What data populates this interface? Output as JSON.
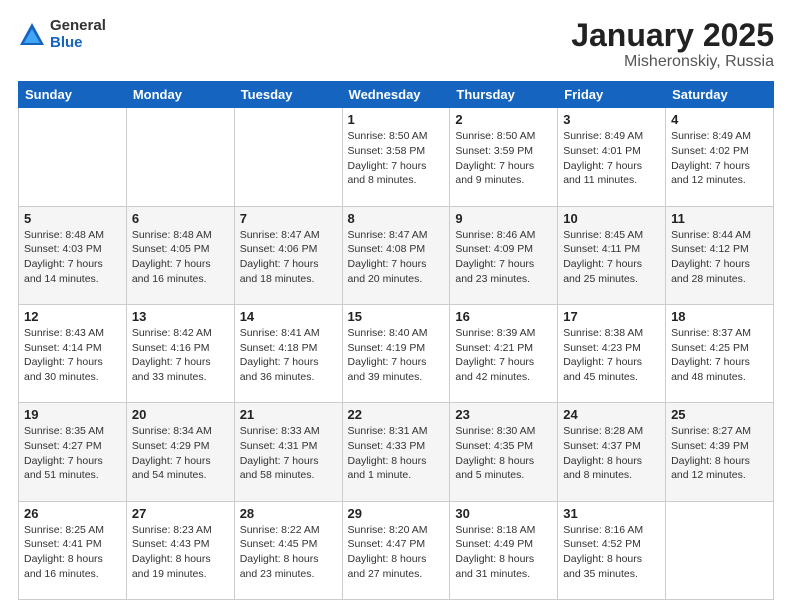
{
  "logo": {
    "general": "General",
    "blue": "Blue"
  },
  "title": "January 2025",
  "subtitle": "Misheronskiy, Russia",
  "days_header": [
    "Sunday",
    "Monday",
    "Tuesday",
    "Wednesday",
    "Thursday",
    "Friday",
    "Saturday"
  ],
  "weeks": [
    [
      {
        "day": "",
        "detail": ""
      },
      {
        "day": "",
        "detail": ""
      },
      {
        "day": "",
        "detail": ""
      },
      {
        "day": "1",
        "detail": "Sunrise: 8:50 AM\nSunset: 3:58 PM\nDaylight: 7 hours\nand 8 minutes."
      },
      {
        "day": "2",
        "detail": "Sunrise: 8:50 AM\nSunset: 3:59 PM\nDaylight: 7 hours\nand 9 minutes."
      },
      {
        "day": "3",
        "detail": "Sunrise: 8:49 AM\nSunset: 4:01 PM\nDaylight: 7 hours\nand 11 minutes."
      },
      {
        "day": "4",
        "detail": "Sunrise: 8:49 AM\nSunset: 4:02 PM\nDaylight: 7 hours\nand 12 minutes."
      }
    ],
    [
      {
        "day": "5",
        "detail": "Sunrise: 8:48 AM\nSunset: 4:03 PM\nDaylight: 7 hours\nand 14 minutes."
      },
      {
        "day": "6",
        "detail": "Sunrise: 8:48 AM\nSunset: 4:05 PM\nDaylight: 7 hours\nand 16 minutes."
      },
      {
        "day": "7",
        "detail": "Sunrise: 8:47 AM\nSunset: 4:06 PM\nDaylight: 7 hours\nand 18 minutes."
      },
      {
        "day": "8",
        "detail": "Sunrise: 8:47 AM\nSunset: 4:08 PM\nDaylight: 7 hours\nand 20 minutes."
      },
      {
        "day": "9",
        "detail": "Sunrise: 8:46 AM\nSunset: 4:09 PM\nDaylight: 7 hours\nand 23 minutes."
      },
      {
        "day": "10",
        "detail": "Sunrise: 8:45 AM\nSunset: 4:11 PM\nDaylight: 7 hours\nand 25 minutes."
      },
      {
        "day": "11",
        "detail": "Sunrise: 8:44 AM\nSunset: 4:12 PM\nDaylight: 7 hours\nand 28 minutes."
      }
    ],
    [
      {
        "day": "12",
        "detail": "Sunrise: 8:43 AM\nSunset: 4:14 PM\nDaylight: 7 hours\nand 30 minutes."
      },
      {
        "day": "13",
        "detail": "Sunrise: 8:42 AM\nSunset: 4:16 PM\nDaylight: 7 hours\nand 33 minutes."
      },
      {
        "day": "14",
        "detail": "Sunrise: 8:41 AM\nSunset: 4:18 PM\nDaylight: 7 hours\nand 36 minutes."
      },
      {
        "day": "15",
        "detail": "Sunrise: 8:40 AM\nSunset: 4:19 PM\nDaylight: 7 hours\nand 39 minutes."
      },
      {
        "day": "16",
        "detail": "Sunrise: 8:39 AM\nSunset: 4:21 PM\nDaylight: 7 hours\nand 42 minutes."
      },
      {
        "day": "17",
        "detail": "Sunrise: 8:38 AM\nSunset: 4:23 PM\nDaylight: 7 hours\nand 45 minutes."
      },
      {
        "day": "18",
        "detail": "Sunrise: 8:37 AM\nSunset: 4:25 PM\nDaylight: 7 hours\nand 48 minutes."
      }
    ],
    [
      {
        "day": "19",
        "detail": "Sunrise: 8:35 AM\nSunset: 4:27 PM\nDaylight: 7 hours\nand 51 minutes."
      },
      {
        "day": "20",
        "detail": "Sunrise: 8:34 AM\nSunset: 4:29 PM\nDaylight: 7 hours\nand 54 minutes."
      },
      {
        "day": "21",
        "detail": "Sunrise: 8:33 AM\nSunset: 4:31 PM\nDaylight: 7 hours\nand 58 minutes."
      },
      {
        "day": "22",
        "detail": "Sunrise: 8:31 AM\nSunset: 4:33 PM\nDaylight: 8 hours\nand 1 minute."
      },
      {
        "day": "23",
        "detail": "Sunrise: 8:30 AM\nSunset: 4:35 PM\nDaylight: 8 hours\nand 5 minutes."
      },
      {
        "day": "24",
        "detail": "Sunrise: 8:28 AM\nSunset: 4:37 PM\nDaylight: 8 hours\nand 8 minutes."
      },
      {
        "day": "25",
        "detail": "Sunrise: 8:27 AM\nSunset: 4:39 PM\nDaylight: 8 hours\nand 12 minutes."
      }
    ],
    [
      {
        "day": "26",
        "detail": "Sunrise: 8:25 AM\nSunset: 4:41 PM\nDaylight: 8 hours\nand 16 minutes."
      },
      {
        "day": "27",
        "detail": "Sunrise: 8:23 AM\nSunset: 4:43 PM\nDaylight: 8 hours\nand 19 minutes."
      },
      {
        "day": "28",
        "detail": "Sunrise: 8:22 AM\nSunset: 4:45 PM\nDaylight: 8 hours\nand 23 minutes."
      },
      {
        "day": "29",
        "detail": "Sunrise: 8:20 AM\nSunset: 4:47 PM\nDaylight: 8 hours\nand 27 minutes."
      },
      {
        "day": "30",
        "detail": "Sunrise: 8:18 AM\nSunset: 4:49 PM\nDaylight: 8 hours\nand 31 minutes."
      },
      {
        "day": "31",
        "detail": "Sunrise: 8:16 AM\nSunset: 4:52 PM\nDaylight: 8 hours\nand 35 minutes."
      },
      {
        "day": "",
        "detail": ""
      }
    ]
  ]
}
